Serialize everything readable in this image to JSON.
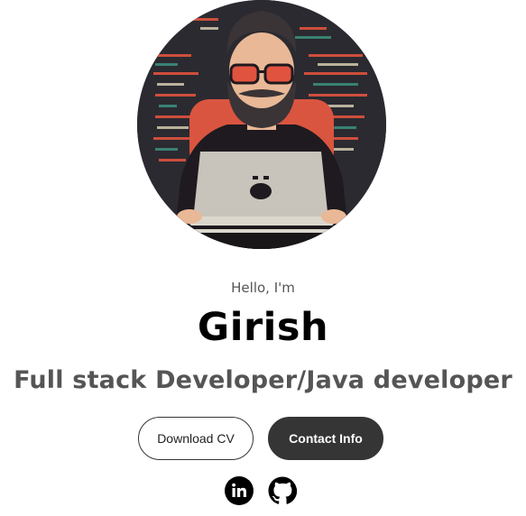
{
  "profile": {
    "image_icon": "developer-avatar-illustration"
  },
  "hero": {
    "greeting": "Hello, I'm",
    "name": "Girish",
    "role": "Full stack Developer/Java developer"
  },
  "buttons": {
    "download_cv": "Download CV",
    "contact_info": "Contact Info"
  },
  "socials": [
    {
      "icon": "linkedin-icon"
    },
    {
      "icon": "github-icon"
    }
  ],
  "colors": {
    "button_dark": "#353535",
    "text_muted": "#555555",
    "accent_red": "#e0533f"
  }
}
